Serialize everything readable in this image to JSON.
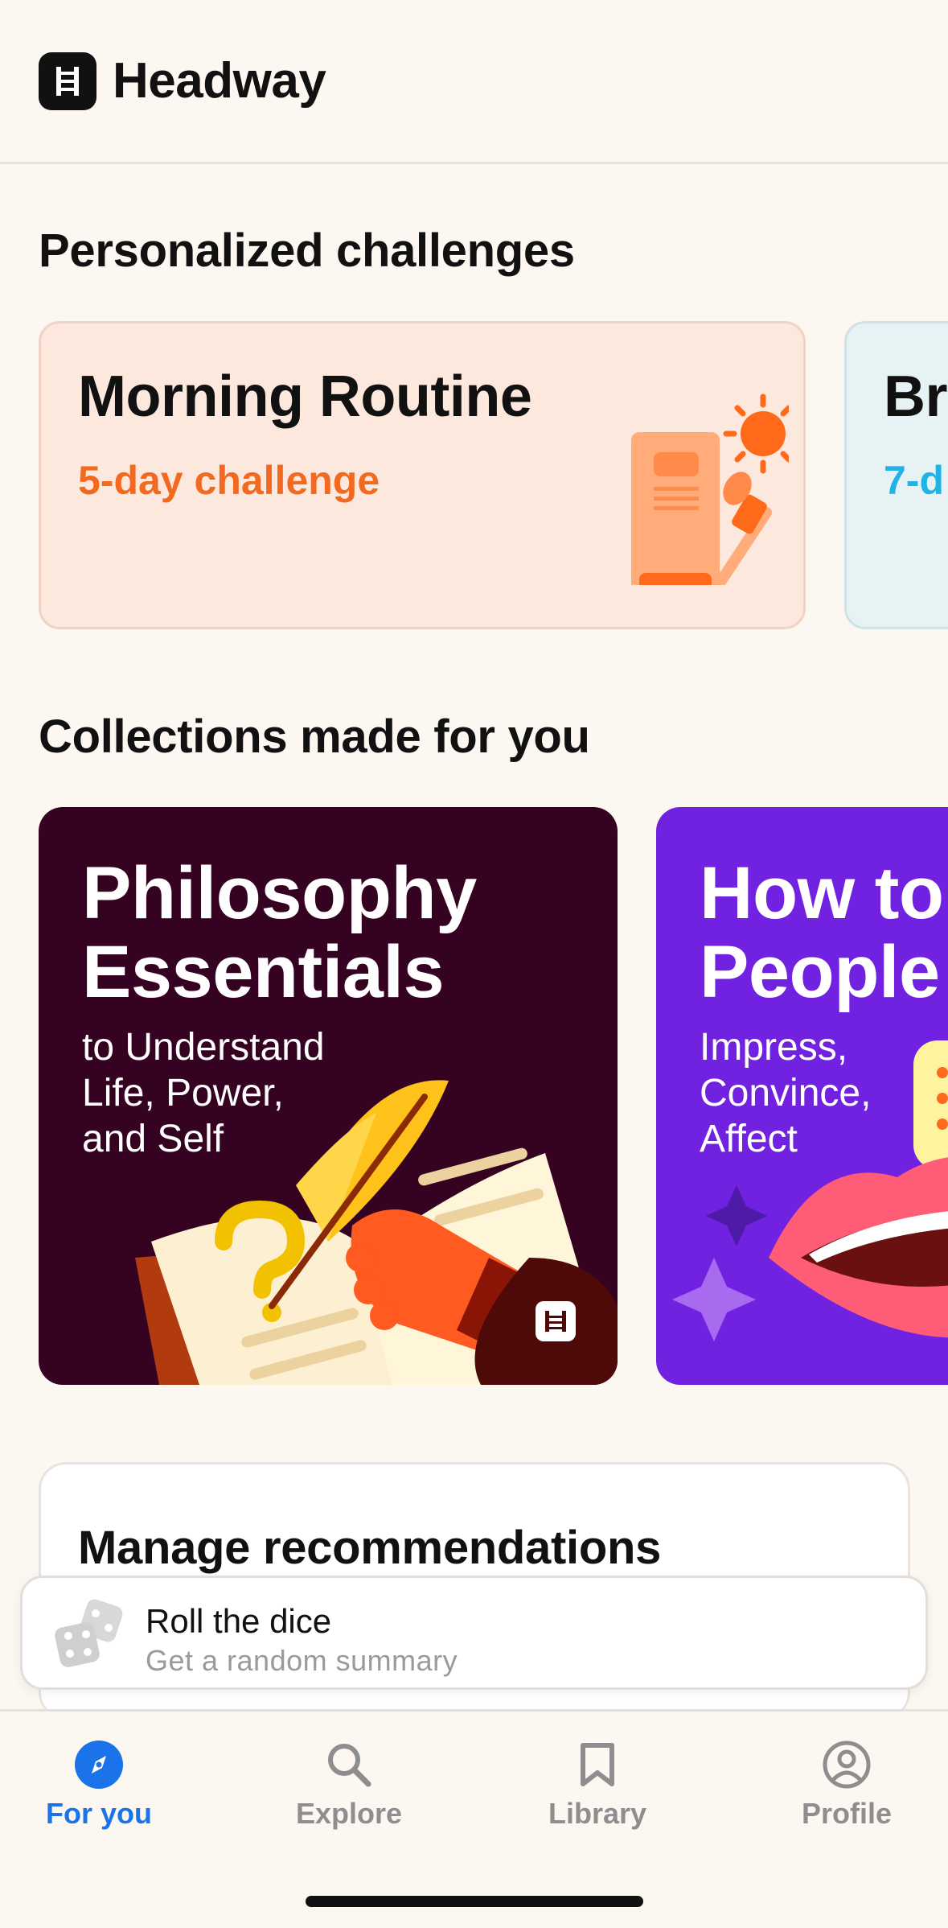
{
  "app": {
    "name": "Headway"
  },
  "challenges": {
    "section_title": "Personalized challenges",
    "cards": [
      {
        "title": "Morning Routine",
        "subtitle": "5-day challenge"
      },
      {
        "title": "Br",
        "subtitle": "7-d"
      }
    ]
  },
  "collections": {
    "section_title": "Collections made for you",
    "cards": [
      {
        "title_line1": "Philosophy",
        "title_line2": "Essentials",
        "sub_line1": "to Understand",
        "sub_line2": "Life, Power,",
        "sub_line3": "and Self"
      },
      {
        "title_line1": "How to",
        "title_line2": "People",
        "sub_line1": "Impress,",
        "sub_line2": "Convince,",
        "sub_line3": "Affect"
      }
    ]
  },
  "manage": {
    "title": "Manage recommendations"
  },
  "dice": {
    "title": "Roll the dice",
    "subtitle": "Get a random summary"
  },
  "nav": {
    "items": [
      {
        "label": "For you",
        "icon": "compass-icon",
        "active": true
      },
      {
        "label": "Explore",
        "icon": "search-icon",
        "active": false
      },
      {
        "label": "Library",
        "icon": "bookmark-icon",
        "active": false
      },
      {
        "label": "Profile",
        "icon": "user-icon",
        "active": false
      }
    ]
  },
  "colors": {
    "accent": "#1a73e8",
    "challenge_orange": "#f26a21",
    "challenge_blue": "#20b4e6",
    "philosophy_bg": "#360221",
    "people_bg": "#7122e0"
  }
}
